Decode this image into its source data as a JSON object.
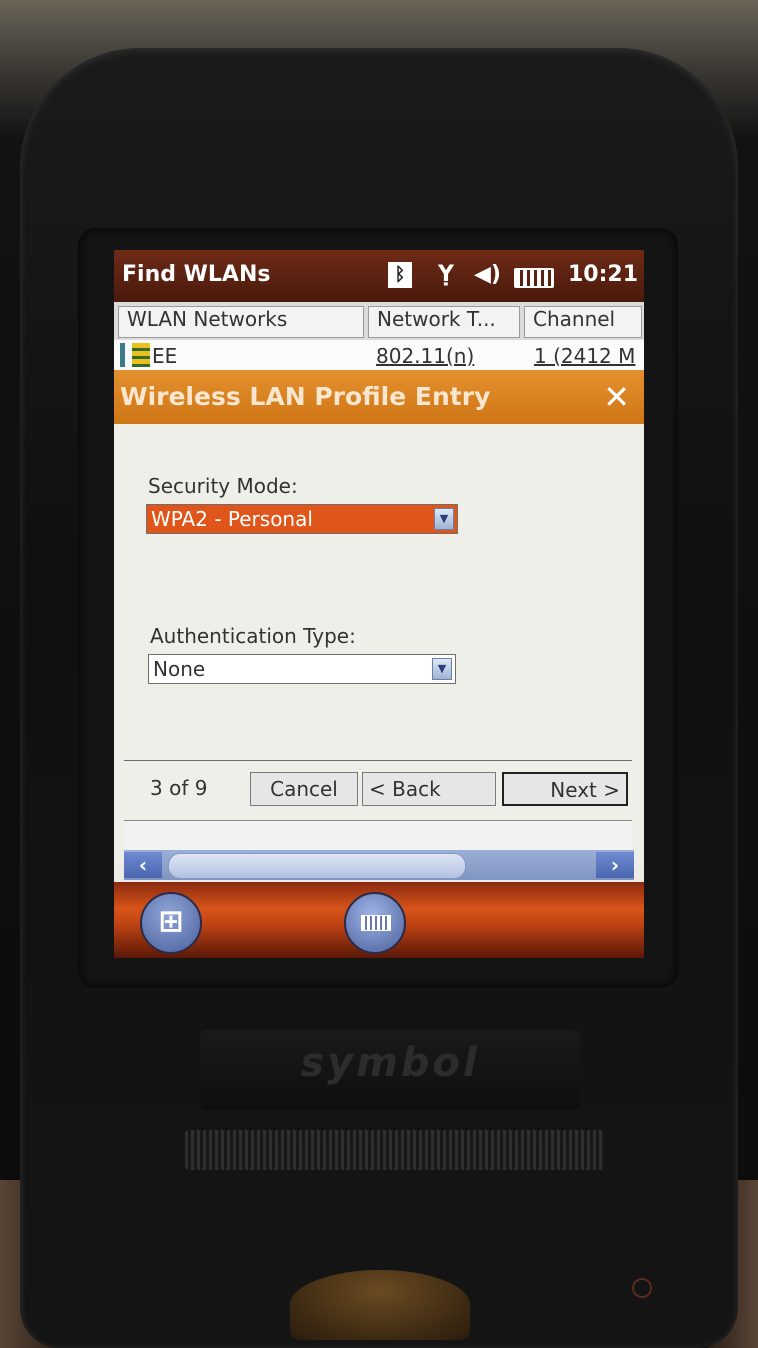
{
  "status_bar": {
    "title": "Find WLANs",
    "bluetooth_icon": "bluetooth-icon",
    "signal_icon": "signal-antenna-icon",
    "volume_icon": "volume-icon",
    "battery_icon": "battery-icon",
    "time": "10:21"
  },
  "list": {
    "columns": [
      "WLAN Networks",
      "Network T...",
      "Channel"
    ],
    "rows": [
      {
        "ssid": "EE",
        "network_type": "802.11(n)",
        "channel": "1 (2412 M"
      }
    ]
  },
  "dialog": {
    "title": "Wireless LAN Profile Entry",
    "close_label": "✕",
    "security_mode_label": "Security Mode:",
    "security_mode_value": "WPA2 - Personal",
    "auth_type_label": "Authentication Type:",
    "auth_type_value": "None",
    "page_indicator": "3 of 9",
    "cancel_label": "Cancel",
    "back_label": "< Back",
    "next_label": "Next >"
  },
  "taskbar": {
    "start_icon": "windows-start-icon",
    "keyboard_icon": "keyboard-icon"
  },
  "device": {
    "brand": "symbol"
  },
  "colors": {
    "title_bar": "#5a1e10",
    "dialog_header": "#d97f20",
    "selected_field": "#e0561a",
    "taskbar": "#c04414",
    "scrollbar": "#8ea3cf"
  }
}
